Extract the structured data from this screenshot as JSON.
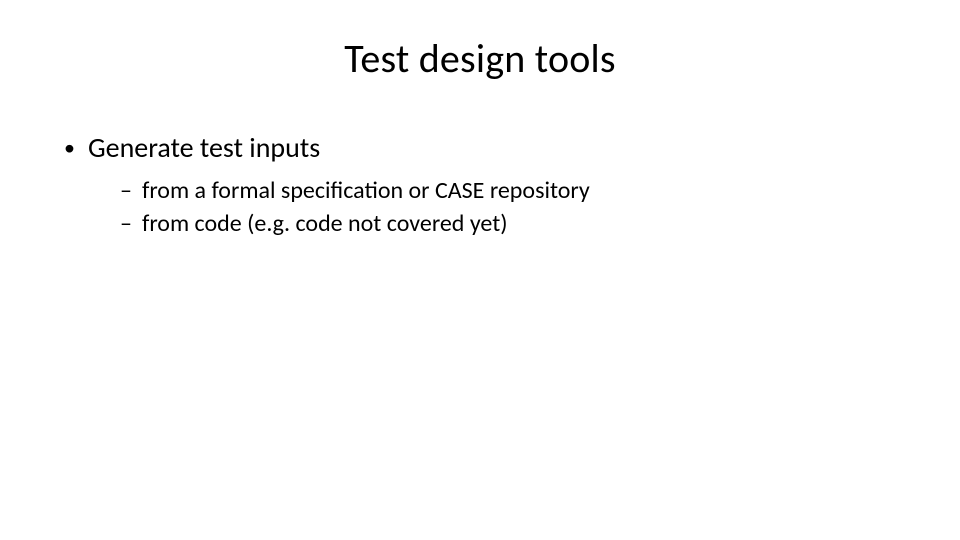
{
  "slide": {
    "title": "Test design tools",
    "bullets": [
      {
        "text": "Generate test inputs",
        "children": [
          {
            "text": "from a formal specification or CASE repository"
          },
          {
            "text": "from code (e.g. code not covered yet)"
          }
        ]
      }
    ]
  }
}
